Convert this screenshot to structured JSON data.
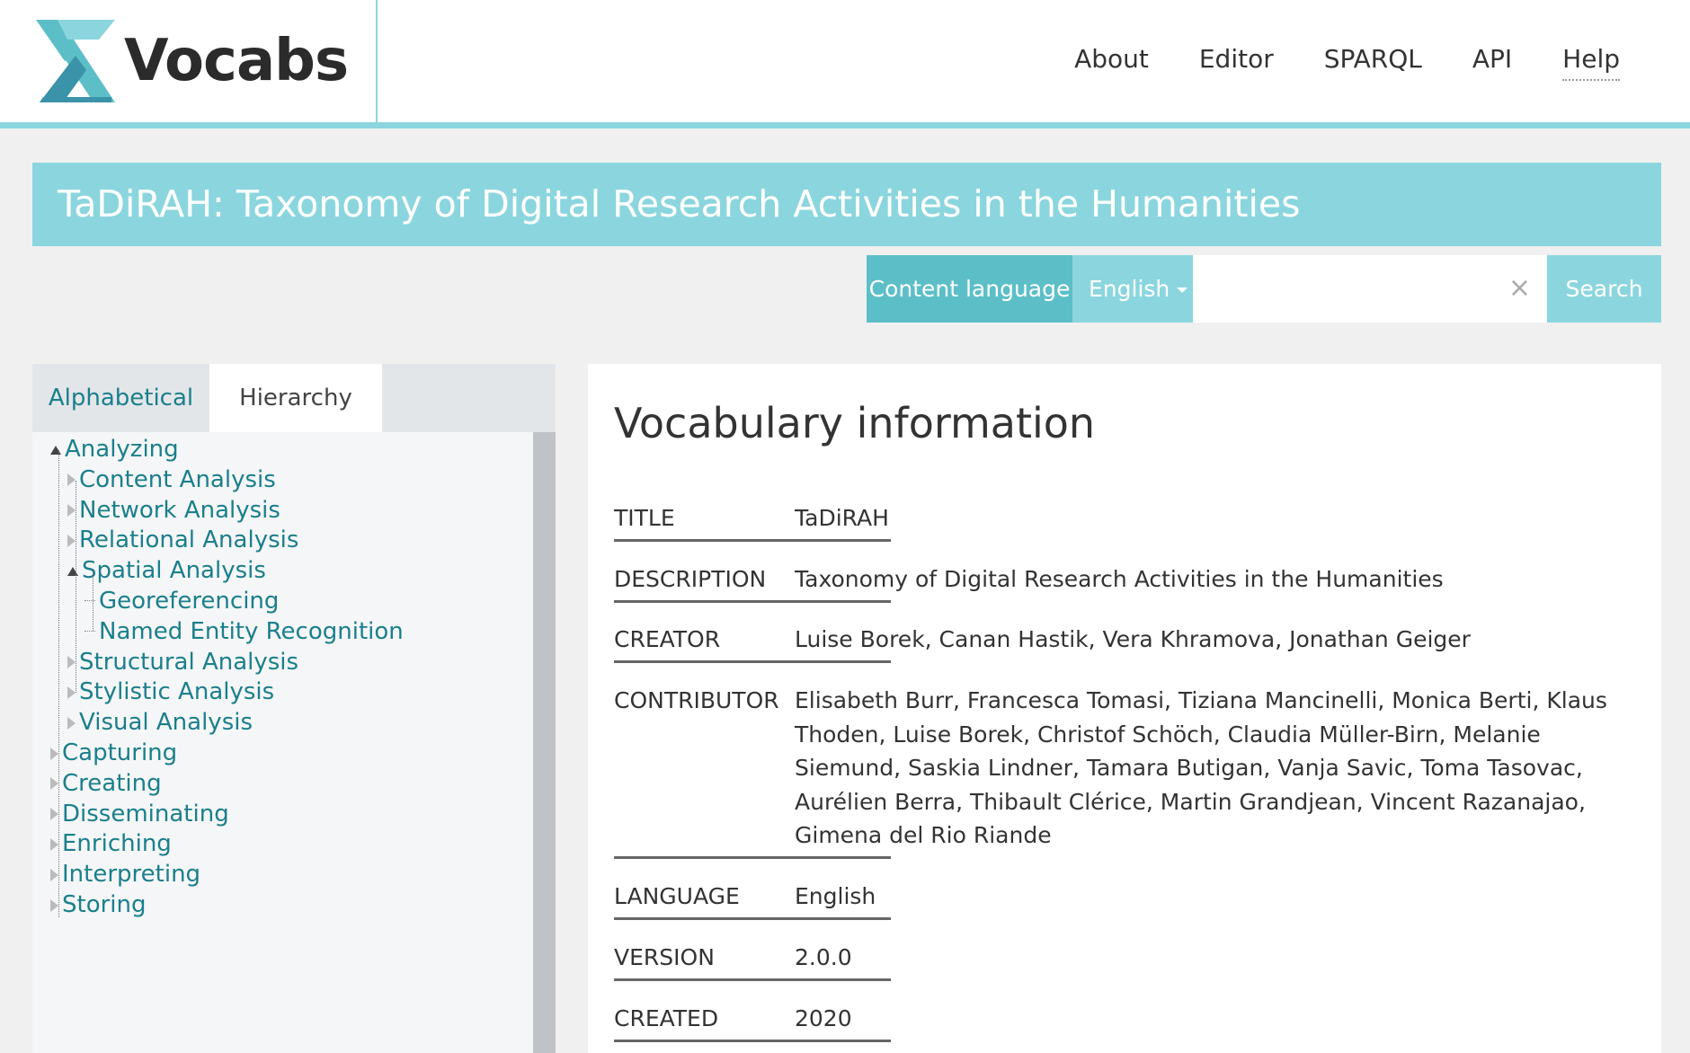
{
  "brand": {
    "name": "Vocabs",
    "accent": "#8bd6de",
    "accent_dark": "#5cbfc8",
    "link": "#1a7f8c"
  },
  "nav": [
    "About",
    "Editor",
    "SPARQL",
    "API",
    "Help"
  ],
  "banner": {
    "title": "TaDiRAH: Taxonomy of Digital Research Activities in the Humanities"
  },
  "search": {
    "language_label": "Content language",
    "language_value": "English",
    "query": "",
    "clear_icon": "×",
    "button": "Search"
  },
  "tabs": {
    "alphabetical": "Alphabetical",
    "hierarchy": "Hierarchy",
    "active": "Hierarchy"
  },
  "tree": [
    {
      "label": "Analyzing",
      "level": 0,
      "state": "open"
    },
    {
      "label": "Content Analysis",
      "level": 1,
      "state": "closed"
    },
    {
      "label": "Network Analysis",
      "level": 1,
      "state": "closed"
    },
    {
      "label": "Relational Analysis",
      "level": 1,
      "state": "closed"
    },
    {
      "label": "Spatial Analysis",
      "level": 1,
      "state": "open"
    },
    {
      "label": "Georeferencing",
      "level": 2,
      "state": "leaf"
    },
    {
      "label": "Named Entity Recognition",
      "level": 2,
      "state": "leaf"
    },
    {
      "label": "Structural Analysis",
      "level": 1,
      "state": "closed"
    },
    {
      "label": "Stylistic Analysis",
      "level": 1,
      "state": "closed"
    },
    {
      "label": "Visual Analysis",
      "level": 1,
      "state": "closed"
    },
    {
      "label": "Capturing",
      "level": 0,
      "state": "closed"
    },
    {
      "label": "Creating",
      "level": 0,
      "state": "closed"
    },
    {
      "label": "Disseminating",
      "level": 0,
      "state": "closed"
    },
    {
      "label": "Enriching",
      "level": 0,
      "state": "closed"
    },
    {
      "label": "Interpreting",
      "level": 0,
      "state": "closed"
    },
    {
      "label": "Storing",
      "level": 0,
      "state": "closed"
    }
  ],
  "info": {
    "heading": "Vocabulary information",
    "rows": [
      {
        "label": "TITLE",
        "value": "TaDiRAH"
      },
      {
        "label": "DESCRIPTION",
        "value": "Taxonomy of Digital Research Activities in the Humanities"
      },
      {
        "label": "CREATOR",
        "value": "Luise Borek, Canan Hastik, Vera Khramova, Jonathan Geiger"
      },
      {
        "label": "CONTRIBUTOR",
        "value": "Elisabeth Burr, Francesca Tomasi, Tiziana Mancinelli, Monica Berti, Klaus Thoden, Luise Borek, Christof Schöch, Claudia Müller-Birn, Melanie Siemund, Saskia Lindner, Tamara Butigan, Vanja Savic, Toma Tasovac, Aurélien Berra, Thibault Clérice, Martin Grandjean, Vincent Razanajao, Gimena del Rio Riande"
      },
      {
        "label": "LANGUAGE",
        "value": "English"
      },
      {
        "label": "VERSION",
        "value": "2.0.0"
      },
      {
        "label": "CREATED",
        "value": "2020"
      }
    ]
  }
}
